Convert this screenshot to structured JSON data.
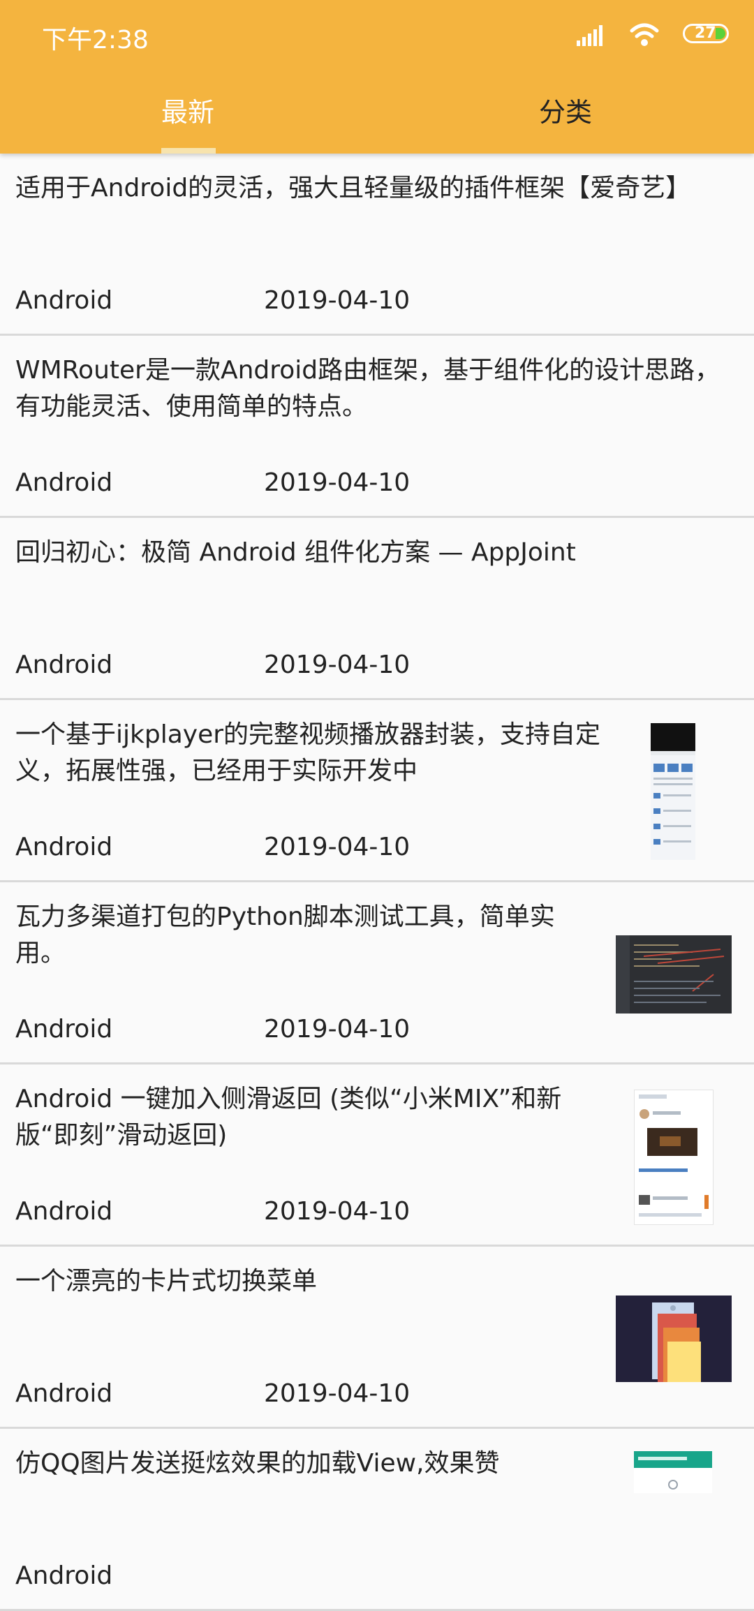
{
  "status_bar": {
    "time": "下午2:38",
    "battery": "27"
  },
  "tabs": [
    {
      "label": "最新",
      "active": true
    },
    {
      "label": "分类",
      "active": false
    }
  ],
  "colors": {
    "accent": "#f4b43f",
    "tab_active": "#ffffff",
    "tab_inactive": "#222222"
  },
  "articles": [
    {
      "title": "适用于Android的灵活，强大且轻量级的插件框架【爱奇艺】",
      "category": "Android",
      "date": "2019-04-10",
      "thumbnail": ""
    },
    {
      "title": "WMRouter是一款Android路由框架，基于组件化的设计思路，有功能灵活、使用简单的特点。",
      "category": "Android",
      "date": "2019-04-10",
      "thumbnail": ""
    },
    {
      "title": "回归初心：极简 Android 组件化方案 — AppJoint",
      "category": "Android",
      "date": "2019-04-10",
      "thumbnail": ""
    },
    {
      "title": "一个基于ijkplayer的完整视频播放器封装，支持自定义，拓展性强，已经用于实际开发中",
      "category": "Android",
      "date": "2019-04-10",
      "thumbnail": "phone-screenshot"
    },
    {
      "title": "瓦力多渠道打包的Python脚本测试工具，简单实用。",
      "category": "Android",
      "date": "2019-04-10",
      "thumbnail": "code-editor"
    },
    {
      "title": "Android 一键加入侧滑返回 (类似“小米MIX”和新版“即刻”滑动返回)",
      "category": "Android",
      "date": "2019-04-10",
      "thumbnail": "app-feed"
    },
    {
      "title": "一个漂亮的卡片式切换菜单",
      "category": "Android",
      "date": "2019-04-10",
      "thumbnail": "card-menu"
    },
    {
      "title": "仿QQ图片发送挺炫效果的加载View,效果赞",
      "category": "Android",
      "date": "",
      "thumbnail": "loading-view"
    }
  ]
}
